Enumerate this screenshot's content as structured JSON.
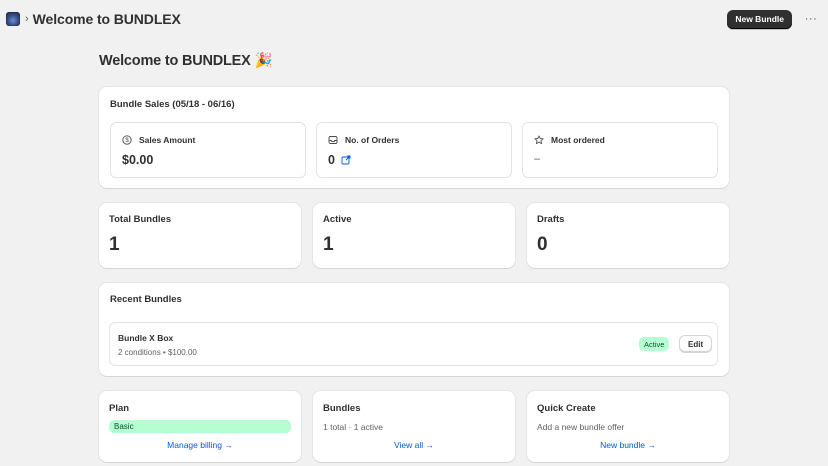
{
  "topbar": {
    "app_icon": "globe-app-icon",
    "title": "Welcome to BUNDLEX",
    "new_bundle_label": "New Bundle",
    "more_label": "···"
  },
  "page": {
    "title": "Welcome to BUNDLEX 🎉"
  },
  "sales": {
    "title": "Bundle Sales (05/18 - 06/16)",
    "stats": [
      {
        "label": "Sales Amount",
        "value": "$0.00",
        "icon": "dollar-circle-icon"
      },
      {
        "label": "No. of Orders",
        "value": "0",
        "icon": "inbox-icon",
        "link_icon": "external-link-icon"
      },
      {
        "label": "Most ordered",
        "value": "–",
        "icon": "star-icon"
      }
    ]
  },
  "counts": [
    {
      "label": "Total Bundles",
      "value": "1"
    },
    {
      "label": "Active",
      "value": "1"
    },
    {
      "label": "Drafts",
      "value": "0"
    }
  ],
  "recent": {
    "title": "Recent Bundles",
    "items": [
      {
        "name": "Bundle X Box",
        "meta": "2 conditions • $100.00",
        "status": "Active",
        "edit_label": "Edit"
      }
    ]
  },
  "plan": {
    "title": "Plan",
    "plan_name": "Basic",
    "link": "Manage billing →"
  },
  "bundles": {
    "title": "Bundles",
    "summary": "1 total · 1 active",
    "link": "View all →"
  },
  "quick_create": {
    "title": "Quick Create",
    "summary": "Add a new bundle offer",
    "link": "New bundle →"
  },
  "colors": {
    "primary_button": "#303030",
    "success_bg": "#b4fed2",
    "success_text": "#0c5132",
    "link": "#005bd3",
    "page_bg": "#f1f1f1"
  }
}
